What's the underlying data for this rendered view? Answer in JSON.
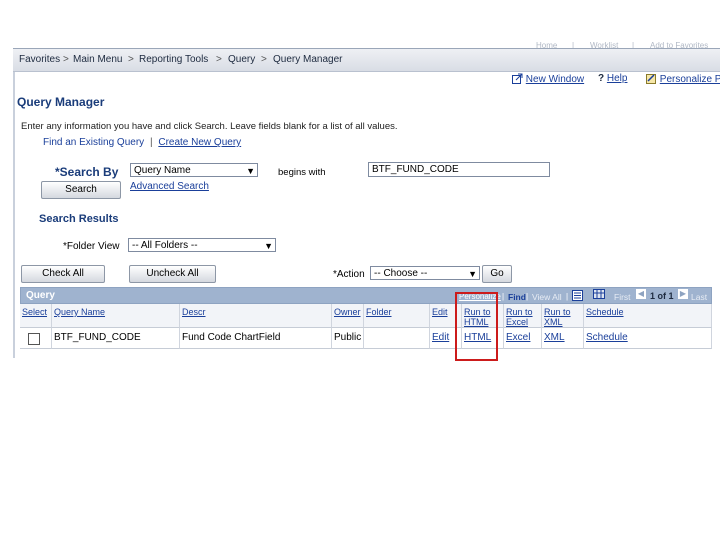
{
  "top_links": [
    "Home",
    "Worklist",
    "Add to Favorites"
  ],
  "nav": {
    "items": [
      "Favorites",
      "Main Menu",
      "Reporting Tools",
      "Query",
      "Query Manager"
    ],
    "separator": ">"
  },
  "toolbar": {
    "new_window": "New Window",
    "help": "Help",
    "personalize": "Personalize Page"
  },
  "page": {
    "title": "Query Manager",
    "instructions": "Enter any information you have and click Search. Leave fields blank for a list of all values.",
    "find_existing": "Find an Existing Query",
    "link_sep": "|",
    "create_new": "Create New Query"
  },
  "search": {
    "label": "*Search By",
    "field_value": "Query Name",
    "operator": "begins with",
    "input_value": "BTF_FUND_CODE",
    "search_button": "Search",
    "advanced": "Advanced Search"
  },
  "results": {
    "title": "Search Results",
    "folder_label": "*Folder View",
    "folder_value": "-- All Folders --",
    "check_all": "Check All",
    "uncheck_all": "Uncheck All",
    "action_label": "*Action",
    "action_value": "-- Choose --",
    "go": "Go"
  },
  "grid": {
    "title": "Query",
    "personalize": "Personalize",
    "find": "Find",
    "view_all": "View All",
    "first": "First",
    "page_info": "1 of 1",
    "last": "Last",
    "columns": [
      "Select",
      "Query Name",
      "Descr",
      "Owner",
      "Folder",
      "Edit",
      "Run to HTML",
      "Run to Excel",
      "Run to XML",
      "Schedule"
    ],
    "rows": [
      {
        "query_name": "BTF_FUND_CODE",
        "descr": "Fund Code ChartField",
        "owner": "Public",
        "folder": "",
        "edit": "Edit",
        "html": "HTML",
        "excel": "Excel",
        "xml": "XML",
        "schedule": "Schedule"
      }
    ]
  },
  "colors": {
    "heading": "#1a3c7a",
    "link": "#1a3f9a",
    "grid_header": "#9fb3cf",
    "highlight": "#cc1b1b"
  }
}
